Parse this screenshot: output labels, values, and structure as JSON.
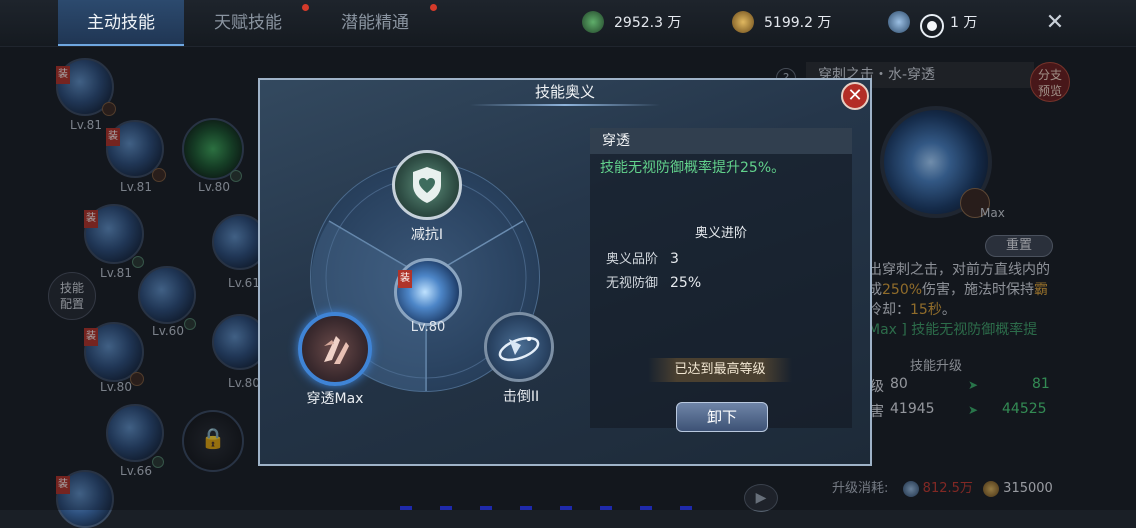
{
  "tabs": [
    {
      "label": "主动技能",
      "active": true
    },
    {
      "label": "天赋技能",
      "active": false,
      "dot": true
    },
    {
      "label": "潜能精通",
      "active": false,
      "dot": true
    }
  ],
  "resources": {
    "r1": "2952.3 万",
    "r2": "5199.2 万",
    "r3": "1 万"
  },
  "left_tree": {
    "skills": [
      {
        "level": "Lv.81",
        "equipped": true
      },
      {
        "level": "Lv.81",
        "equipped": true
      },
      {
        "level": "Lv.80"
      },
      {
        "level": "Lv.81",
        "equipped": true
      },
      {
        "level": "Lv.61"
      },
      {
        "level": "Lv.60"
      },
      {
        "level": "Lv.80",
        "equipped": true
      },
      {
        "level": "Lv.80"
      },
      {
        "level": "Lv.66"
      },
      {
        "level": ""
      }
    ],
    "config_button": "技能\n配置",
    "equip_tag": "装"
  },
  "right_panel": {
    "title": "穿刺之击・水-穿透",
    "branch_preview": "分支\n预览",
    "max_label": "Max",
    "reset_button": "重置",
    "desc_part1": "出穿刺之击，对前方直线内的",
    "desc_part2_pre": "成",
    "desc_part2_hl": "250%",
    "desc_part2_post": "伤害，施法时保持",
    "desc_part2_tail": "霸",
    "desc_part3_pre": "冷却：",
    "desc_part3_hl": "15秒",
    "desc_part3_post": "。",
    "desc_part4": "Max ] 技能无视防御概率提",
    "upgrade_title": "技能升级",
    "upgrade_rows": [
      {
        "label": "级",
        "current": "80",
        "next": "81"
      },
      {
        "label": "害",
        "current": "41945",
        "next": "44525"
      }
    ],
    "cost_label": "升级消耗:",
    "cost_value_1": "812.5万",
    "cost_value_2": "315000"
  },
  "modal": {
    "title": "技能奥义",
    "close": "✕",
    "nodes": {
      "shield_label": "减抗I",
      "center_level": "Lv.80",
      "center_tag": "装",
      "pierce_label": "穿透Max",
      "knock_label": "击倒II"
    },
    "info": {
      "header": "穿透",
      "desc": "技能无视防御概率提升25%。",
      "advance_title": "奥义进阶",
      "stats": [
        {
          "key": "奥义品阶",
          "value": "3"
        },
        {
          "key": "无视防御",
          "value": "25%"
        }
      ],
      "max_level_text": "已达到最高等级",
      "unload_button": "卸下"
    }
  },
  "colors": {
    "accent_blue": "#3f84d6",
    "green_text": "#62d28c",
    "close_red": "#b32d26",
    "highlight_gold": "#d9a23a"
  }
}
